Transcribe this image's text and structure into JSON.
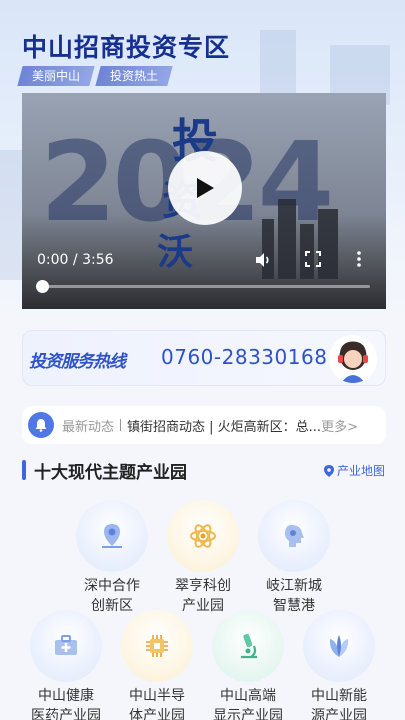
{
  "header": {
    "title": "中山招商投资专区",
    "tags": [
      "美丽中山",
      "投资热土"
    ]
  },
  "video": {
    "current_time": "0:00",
    "duration": "3:56",
    "progress": 0,
    "separator": " / "
  },
  "hotline": {
    "label": "投资服务热线",
    "phone": "0760-28330168"
  },
  "news": {
    "category": "最新动态",
    "text": "镇街招商动态 | 火炬高新区：总...",
    "more": "更多>"
  },
  "section": {
    "title": "十大现代主题产业园",
    "map_link": "产业地图"
  },
  "parks": [
    {
      "name": "深中合作\n创新区",
      "icon": "location-pin-icon"
    },
    {
      "name": "翠亨科创\n产业园",
      "icon": "atom-icon"
    },
    {
      "name": "岐江新城\n智慧港",
      "icon": "brain-icon"
    },
    {
      "name": "中山健康\n医药产业园",
      "icon": "medical-kit-icon"
    },
    {
      "name": "中山半导\n体产业园",
      "icon": "chip-icon"
    },
    {
      "name": "中山高端\n显示产业园",
      "icon": "microscope-icon"
    },
    {
      "name": "中山新能\n源产业园",
      "icon": "leaf-icon"
    }
  ],
  "colors": {
    "primary": "#3d67e0",
    "title": "#16308f"
  }
}
